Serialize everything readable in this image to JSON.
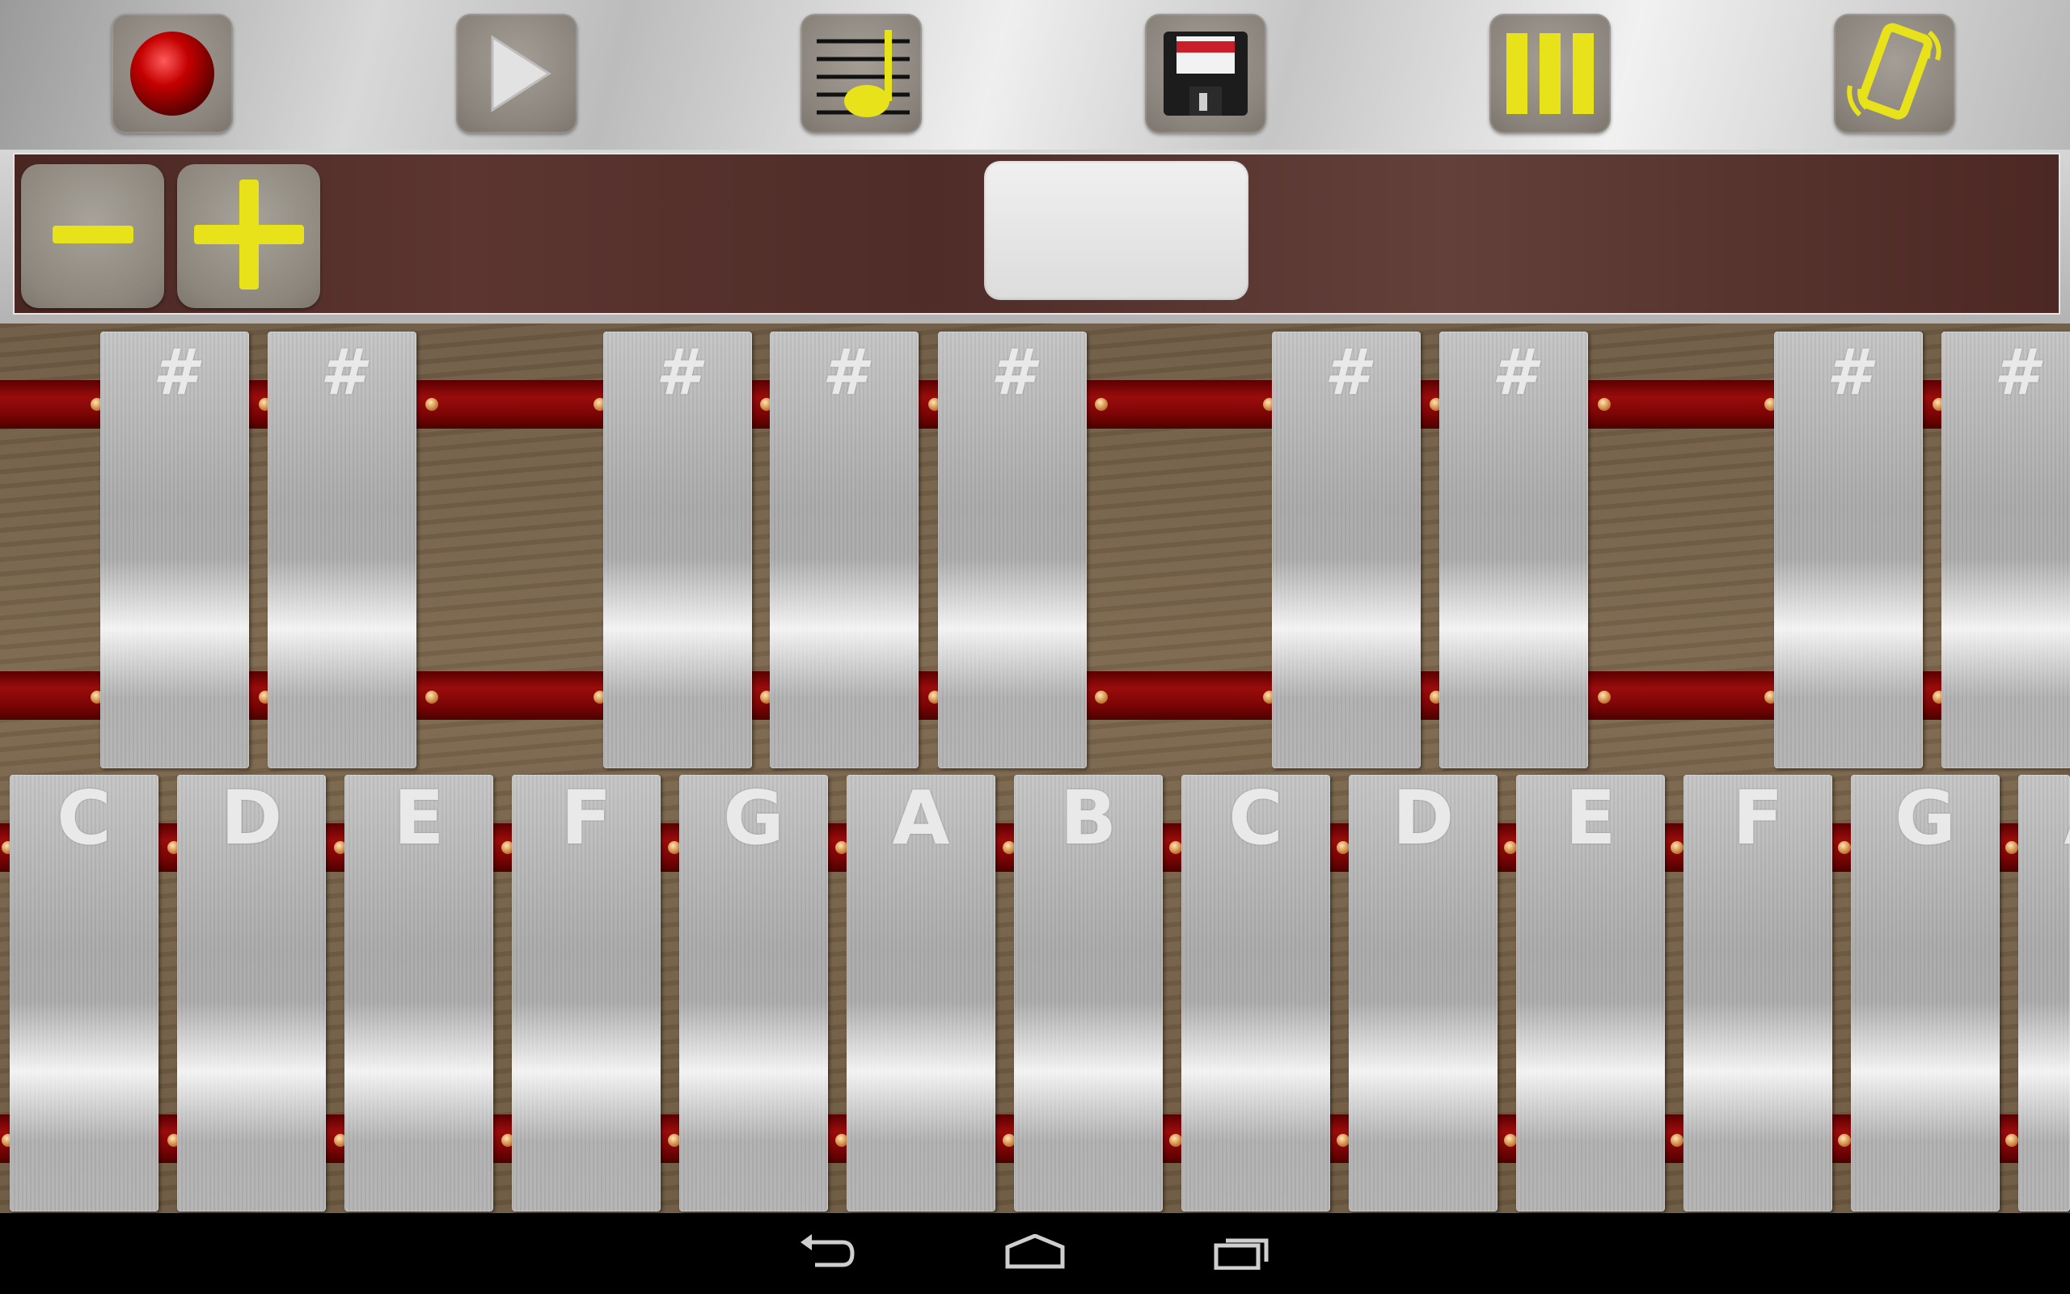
{
  "toolbar": {
    "buttons": [
      {
        "name": "record",
        "icon": "record-icon"
      },
      {
        "name": "play",
        "icon": "play-icon"
      },
      {
        "name": "songs",
        "icon": "music-note-icon"
      },
      {
        "name": "save",
        "icon": "floppy-disk-icon"
      },
      {
        "name": "layout",
        "icon": "bars-icon"
      },
      {
        "name": "rotate",
        "icon": "rotate-device-icon"
      }
    ]
  },
  "controls": {
    "minus_icon": "minus-icon",
    "plus_icon": "plus-icon",
    "tempo_value": ""
  },
  "sharp_bars": [
    {
      "label": "#"
    },
    {
      "label": "#"
    },
    {
      "label": "#"
    },
    {
      "label": "#"
    },
    {
      "label": "#"
    },
    {
      "label": "#"
    },
    {
      "label": "#"
    },
    {
      "label": "#"
    },
    {
      "label": "#"
    }
  ],
  "natural_bars": [
    {
      "label": "C"
    },
    {
      "label": "D"
    },
    {
      "label": "E"
    },
    {
      "label": "F"
    },
    {
      "label": "G"
    },
    {
      "label": "A"
    },
    {
      "label": "B"
    },
    {
      "label": "C"
    },
    {
      "label": "D"
    },
    {
      "label": "E"
    },
    {
      "label": "F"
    },
    {
      "label": "G"
    },
    {
      "label": "A"
    }
  ],
  "navbar": {
    "back_icon": "back-icon",
    "home_icon": "home-icon",
    "recents_icon": "recent-apps-icon"
  },
  "colors": {
    "accent_yellow": "#e8e21a",
    "record_red": "#c40000",
    "rail_red": "#8a0808",
    "panel_brown": "#55302b"
  }
}
